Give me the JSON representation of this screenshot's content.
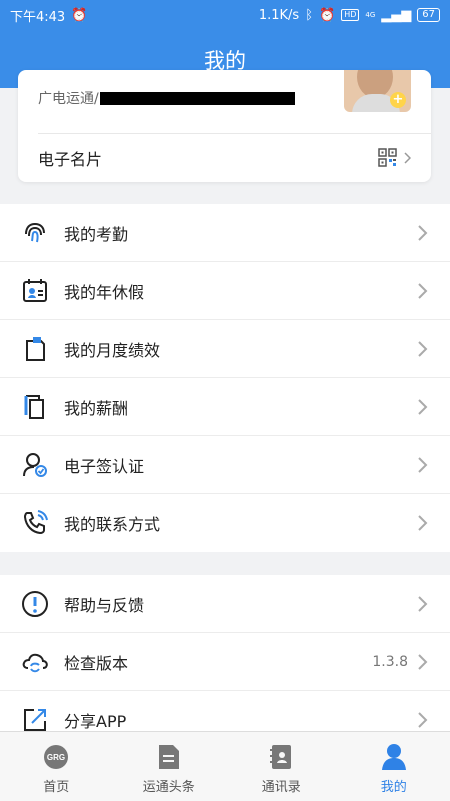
{
  "status_bar": {
    "time": "下午4:43",
    "speed": "1.1K/s",
    "network_badge": "HD",
    "signal_text": "4G",
    "battery": "67"
  },
  "header": {
    "title": "我的"
  },
  "profile": {
    "company_prefix": "广电运通/",
    "business_card_label": "电子名片"
  },
  "menu_group_1": [
    {
      "label": "我的考勤",
      "icon": "fingerprint-icon"
    },
    {
      "label": "我的年休假",
      "icon": "calendar-person-icon"
    },
    {
      "label": "我的月度绩效",
      "icon": "clipboard-document-icon"
    },
    {
      "label": "我的薪酬",
      "icon": "salary-document-icon"
    },
    {
      "label": "电子签认证",
      "icon": "user-verified-icon"
    },
    {
      "label": "我的联系方式",
      "icon": "phone-icon"
    }
  ],
  "menu_group_2": [
    {
      "label": "帮助与反馈",
      "icon": "help-icon",
      "value": ""
    },
    {
      "label": "检查版本",
      "icon": "cloud-sync-icon",
      "value": "1.3.8"
    },
    {
      "label": "分享APP",
      "icon": "share-icon",
      "value": ""
    }
  ],
  "bottom_nav": [
    {
      "label": "首页",
      "icon": "grg-logo-icon",
      "active": false
    },
    {
      "label": "运通头条",
      "icon": "news-icon",
      "active": false
    },
    {
      "label": "通讯录",
      "icon": "contacts-icon",
      "active": false
    },
    {
      "label": "我的",
      "icon": "person-icon",
      "active": true
    }
  ],
  "colors": {
    "primary": "#3a8de8",
    "active_tab": "#2f82e6",
    "icon_blue": "#3488e7"
  }
}
